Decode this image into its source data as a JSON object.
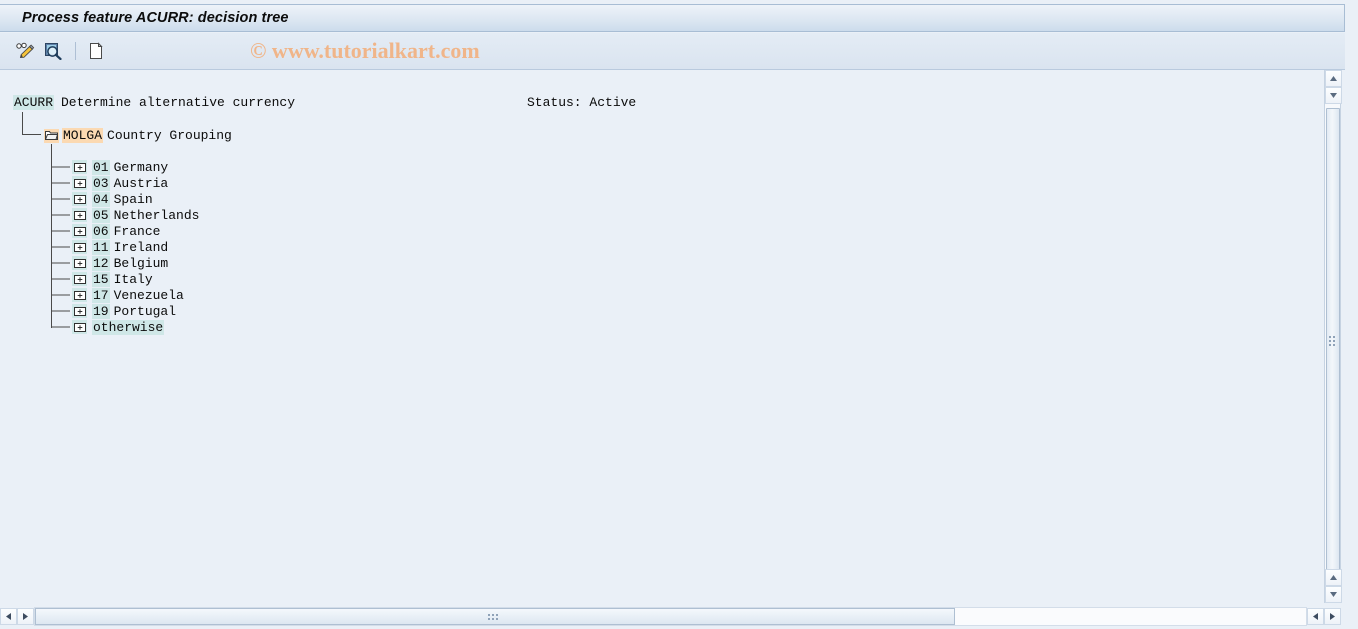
{
  "window": {
    "title": "Process feature ACURR: decision tree"
  },
  "watermark": {
    "text": "© www.tutorialkart.com"
  },
  "toolbar": {
    "buttons": [
      {
        "name": "display-change-icon",
        "tooltip": "Display <-> Change"
      },
      {
        "name": "find-icon",
        "tooltip": "Find"
      },
      {
        "name": "new-document-icon",
        "tooltip": "Create"
      }
    ]
  },
  "feature": {
    "code": "ACURR",
    "description": "Determine alternative currency",
    "status_label": "Status: Active"
  },
  "tree": {
    "root": {
      "code": "MOLGA",
      "label": "Country Grouping",
      "icon": "open-folder-icon"
    },
    "nodes": [
      {
        "key": "01",
        "label": "Germany"
      },
      {
        "key": "03",
        "label": "Austria"
      },
      {
        "key": "04",
        "label": "Spain"
      },
      {
        "key": "05",
        "label": "Netherlands"
      },
      {
        "key": "06",
        "label": "France"
      },
      {
        "key": "11",
        "label": "Ireland"
      },
      {
        "key": "12",
        "label": "Belgium"
      },
      {
        "key": "15",
        "label": "Italy"
      },
      {
        "key": "17",
        "label": "Venezuela"
      },
      {
        "key": "19",
        "label": "Portugal"
      },
      {
        "key": "otherwise",
        "label": ""
      }
    ]
  },
  "colors": {
    "code_highlight": "#cfe7e7",
    "root_highlight": "#fbd9b2",
    "canvas_bg": "#eaf0f7",
    "watermark": "#f0b589",
    "title_text": "#0c0c0c"
  },
  "scrollbars": {
    "vertical": {
      "up": "▲",
      "down": "▼"
    },
    "horizontal": {
      "left": "◀",
      "right": "▶"
    }
  }
}
